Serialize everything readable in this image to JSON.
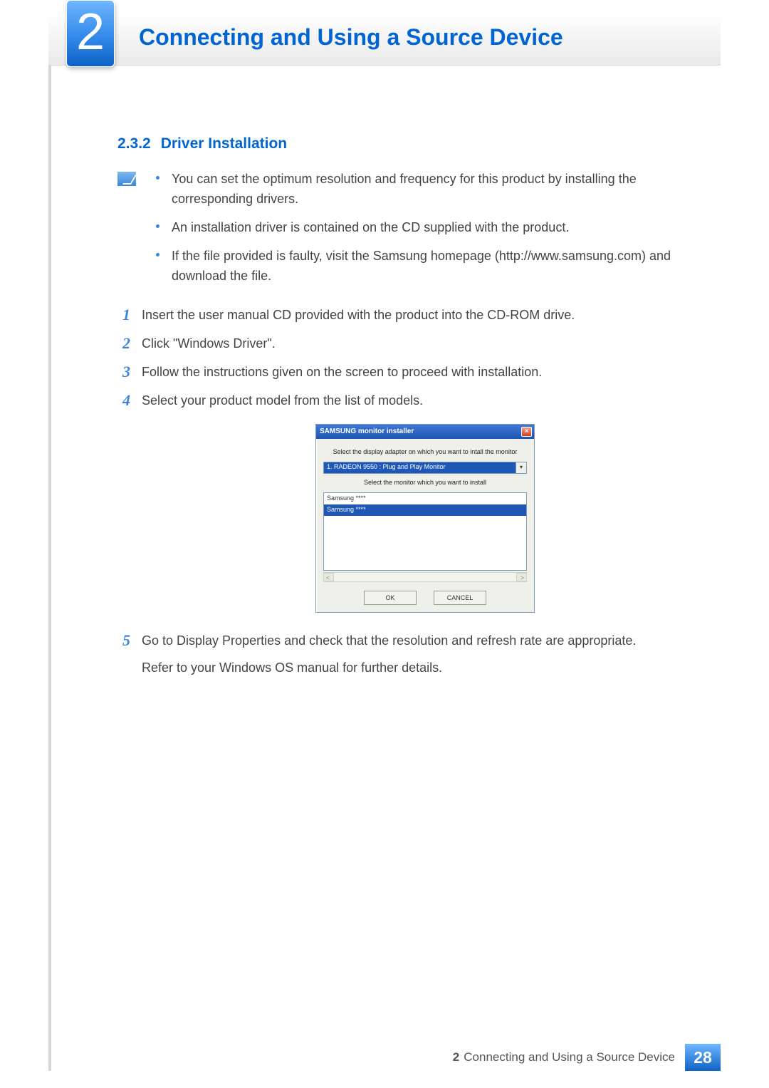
{
  "chapter": {
    "number": "2",
    "title": "Connecting and Using a Source Device"
  },
  "section": {
    "number": "2.3.2",
    "title": "Driver Installation"
  },
  "notes": [
    "You can set the optimum resolution and frequency for this product by installing the corresponding drivers.",
    "An installation driver is contained on the CD supplied with the product.",
    "If the file provided is faulty, visit the Samsung homepage (http://www.samsung.com) and download the file."
  ],
  "steps": {
    "s1": "Insert the user manual CD provided with the product into the CD-ROM drive.",
    "s2": "Click \"Windows Driver\".",
    "s3": "Follow the instructions given on the screen to proceed with installation.",
    "s4": "Select your product model from the list of models.",
    "s5a": "Go to Display Properties and check that the resolution and refresh rate are appropriate.",
    "s5b": "Refer to your Windows OS manual for further details."
  },
  "installer": {
    "title": "SAMSUNG monitor installer",
    "label1": "Select the display adapter on which you want to intall the monitor",
    "adapter": "1. RADEON 9550 : Plug and Play Monitor",
    "label2": "Select the monitor which you want to install",
    "list_item1": "Samsung ****",
    "list_item2": "Samsung ****",
    "ok": "OK",
    "cancel": "CANCEL"
  },
  "footer": {
    "chapter_num": "2",
    "chapter_title": "Connecting and Using a Source Device",
    "page": "28"
  }
}
